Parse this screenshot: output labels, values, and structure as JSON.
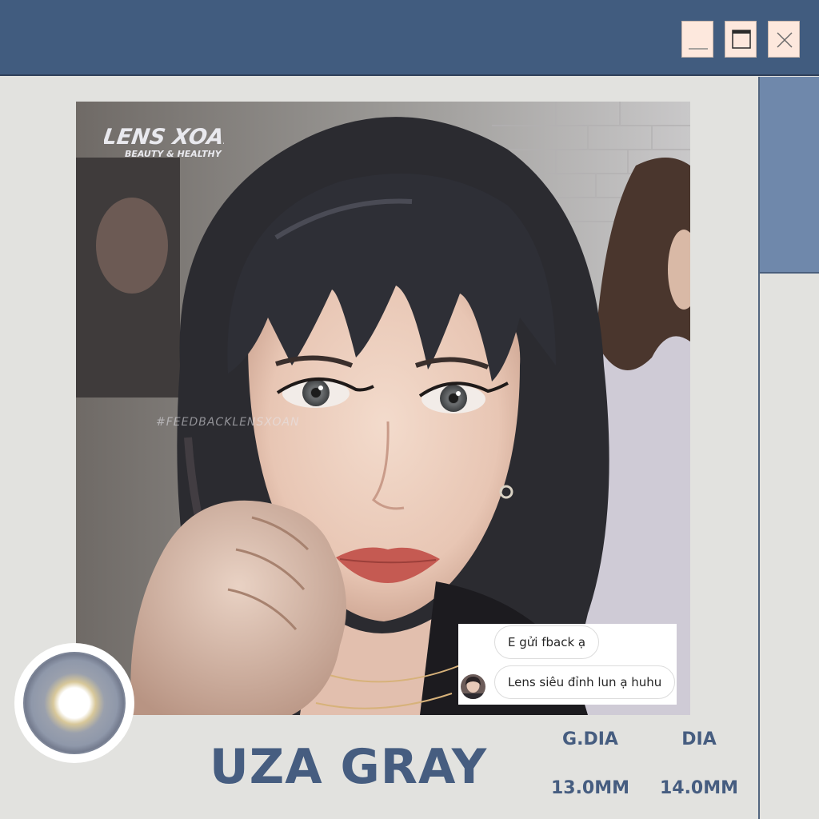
{
  "window": {
    "controls": [
      {
        "name": "minimize",
        "icon": "minimize-icon"
      },
      {
        "name": "maximize",
        "icon": "maximize-icon"
      },
      {
        "name": "close",
        "icon": "close-icon"
      }
    ]
  },
  "photo": {
    "logo_title": "LENS XOAN",
    "logo_subtitle": "BEAUTY & HEALTHY",
    "hashtag": "#FEEDBACKLENSXOAN"
  },
  "chat": {
    "messages": [
      {
        "text": "E gửi fback ạ"
      },
      {
        "text": "Lens siêu đỉnh lun ạ huhu"
      }
    ]
  },
  "product": {
    "name": "UZA GRAY",
    "specs": [
      {
        "label": "G.DIA",
        "value": "13.0MM"
      },
      {
        "label": "DIA",
        "value": "14.0MM"
      }
    ]
  },
  "colors": {
    "titlebar": "#415c7f",
    "accent_panel": "#6f88ab",
    "background": "#e2e2df",
    "text_accent": "#465d80",
    "button_face": "#fde8dd"
  }
}
